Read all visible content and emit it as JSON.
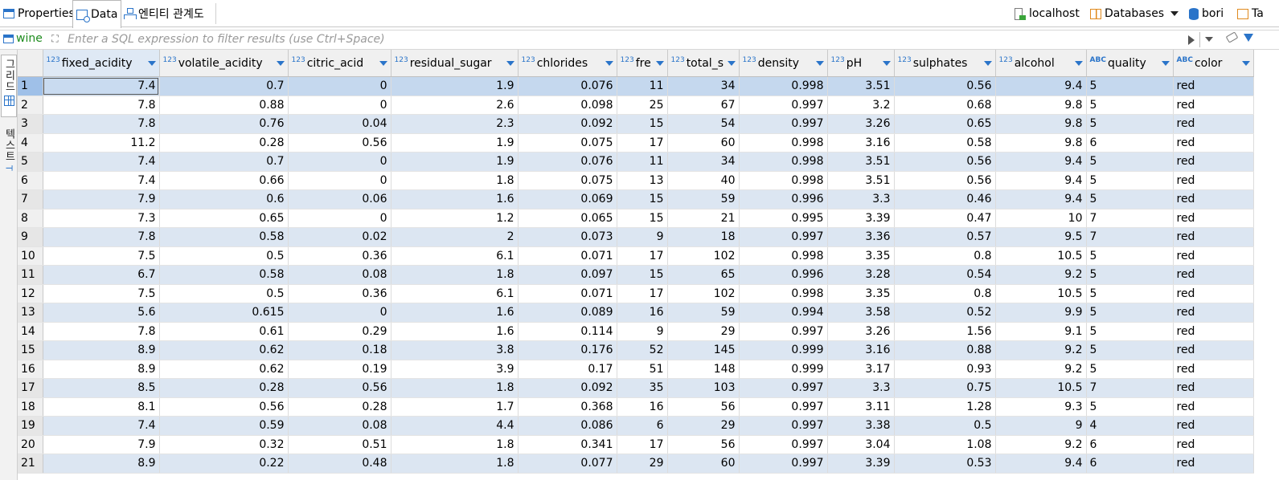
{
  "tabs": [
    {
      "label": "Properties",
      "icon": "properties-icon"
    },
    {
      "label": "Data",
      "icon": "data-icon",
      "active": true
    },
    {
      "label": "엔티티 관계도",
      "icon": "er-diagram-icon"
    }
  ],
  "connection": {
    "host": "localhost",
    "databases": "Databases",
    "db": "bori",
    "table_truncated": "Ta"
  },
  "filter": {
    "table_name": "wine",
    "placeholder": "Enter a SQL expression to filter results (use Ctrl+Space)"
  },
  "side_panel": {
    "grid_label": "그리드",
    "text_label": "텍스트"
  },
  "colors": {
    "accent": "#2a74c9",
    "row_alt": "#dce6f2",
    "selected_row_number": "#9fc0e8",
    "table_name": "#1e8c1e"
  },
  "grid": {
    "columns": [
      {
        "name": "fixed_acidity",
        "type": "123",
        "align": "num",
        "width": 145
      },
      {
        "name": "volatile_acidity",
        "type": "123",
        "align": "num",
        "width": 160
      },
      {
        "name": "citric_acid",
        "type": "123",
        "align": "num",
        "width": 128
      },
      {
        "name": "residual_sugar",
        "type": "123",
        "align": "num",
        "width": 158
      },
      {
        "name": "chlorides",
        "type": "123",
        "align": "num",
        "width": 123
      },
      {
        "name": "fre",
        "type": "123",
        "align": "num",
        "width": 63
      },
      {
        "name": "total_s",
        "type": "123",
        "align": "num",
        "width": 89
      },
      {
        "name": "density",
        "type": "123",
        "align": "num",
        "width": 110
      },
      {
        "name": "pH",
        "type": "123",
        "align": "num",
        "width": 83
      },
      {
        "name": "sulphates",
        "type": "123",
        "align": "num",
        "width": 126
      },
      {
        "name": "alcohol",
        "type": "123",
        "align": "num",
        "width": 113
      },
      {
        "name": "quality",
        "type": "ABC",
        "align": "txt",
        "width": 108
      },
      {
        "name": "color",
        "type": "ABC",
        "align": "txt",
        "width": 100
      }
    ],
    "rows": [
      [
        "7.4",
        "0.7",
        "0",
        "1.9",
        "0.076",
        "11",
        "34",
        "0.998",
        "3.51",
        "0.56",
        "9.4",
        "5",
        "red"
      ],
      [
        "7.8",
        "0.88",
        "0",
        "2.6",
        "0.098",
        "25",
        "67",
        "0.997",
        "3.2",
        "0.68",
        "9.8",
        "5",
        "red"
      ],
      [
        "7.8",
        "0.76",
        "0.04",
        "2.3",
        "0.092",
        "15",
        "54",
        "0.997",
        "3.26",
        "0.65",
        "9.8",
        "5",
        "red"
      ],
      [
        "11.2",
        "0.28",
        "0.56",
        "1.9",
        "0.075",
        "17",
        "60",
        "0.998",
        "3.16",
        "0.58",
        "9.8",
        "6",
        "red"
      ],
      [
        "7.4",
        "0.7",
        "0",
        "1.9",
        "0.076",
        "11",
        "34",
        "0.998",
        "3.51",
        "0.56",
        "9.4",
        "5",
        "red"
      ],
      [
        "7.4",
        "0.66",
        "0",
        "1.8",
        "0.075",
        "13",
        "40",
        "0.998",
        "3.51",
        "0.56",
        "9.4",
        "5",
        "red"
      ],
      [
        "7.9",
        "0.6",
        "0.06",
        "1.6",
        "0.069",
        "15",
        "59",
        "0.996",
        "3.3",
        "0.46",
        "9.4",
        "5",
        "red"
      ],
      [
        "7.3",
        "0.65",
        "0",
        "1.2",
        "0.065",
        "15",
        "21",
        "0.995",
        "3.39",
        "0.47",
        "10",
        "7",
        "red"
      ],
      [
        "7.8",
        "0.58",
        "0.02",
        "2",
        "0.073",
        "9",
        "18",
        "0.997",
        "3.36",
        "0.57",
        "9.5",
        "7",
        "red"
      ],
      [
        "7.5",
        "0.5",
        "0.36",
        "6.1",
        "0.071",
        "17",
        "102",
        "0.998",
        "3.35",
        "0.8",
        "10.5",
        "5",
        "red"
      ],
      [
        "6.7",
        "0.58",
        "0.08",
        "1.8",
        "0.097",
        "15",
        "65",
        "0.996",
        "3.28",
        "0.54",
        "9.2",
        "5",
        "red"
      ],
      [
        "7.5",
        "0.5",
        "0.36",
        "6.1",
        "0.071",
        "17",
        "102",
        "0.998",
        "3.35",
        "0.8",
        "10.5",
        "5",
        "red"
      ],
      [
        "5.6",
        "0.615",
        "0",
        "1.6",
        "0.089",
        "16",
        "59",
        "0.994",
        "3.58",
        "0.52",
        "9.9",
        "5",
        "red"
      ],
      [
        "7.8",
        "0.61",
        "0.29",
        "1.6",
        "0.114",
        "9",
        "29",
        "0.997",
        "3.26",
        "1.56",
        "9.1",
        "5",
        "red"
      ],
      [
        "8.9",
        "0.62",
        "0.18",
        "3.8",
        "0.176",
        "52",
        "145",
        "0.999",
        "3.16",
        "0.88",
        "9.2",
        "5",
        "red"
      ],
      [
        "8.9",
        "0.62",
        "0.19",
        "3.9",
        "0.17",
        "51",
        "148",
        "0.999",
        "3.17",
        "0.93",
        "9.2",
        "5",
        "red"
      ],
      [
        "8.5",
        "0.28",
        "0.56",
        "1.8",
        "0.092",
        "35",
        "103",
        "0.997",
        "3.3",
        "0.75",
        "10.5",
        "7",
        "red"
      ],
      [
        "8.1",
        "0.56",
        "0.28",
        "1.7",
        "0.368",
        "16",
        "56",
        "0.997",
        "3.11",
        "1.28",
        "9.3",
        "5",
        "red"
      ],
      [
        "7.4",
        "0.59",
        "0.08",
        "4.4",
        "0.086",
        "6",
        "29",
        "0.997",
        "3.38",
        "0.5",
        "9",
        "4",
        "red"
      ],
      [
        "7.9",
        "0.32",
        "0.51",
        "1.8",
        "0.341",
        "17",
        "56",
        "0.997",
        "3.04",
        "1.08",
        "9.2",
        "6",
        "red"
      ],
      [
        "8.9",
        "0.22",
        "0.48",
        "1.8",
        "0.077",
        "29",
        "60",
        "0.997",
        "3.39",
        "0.53",
        "9.4",
        "6",
        "red"
      ]
    ]
  }
}
